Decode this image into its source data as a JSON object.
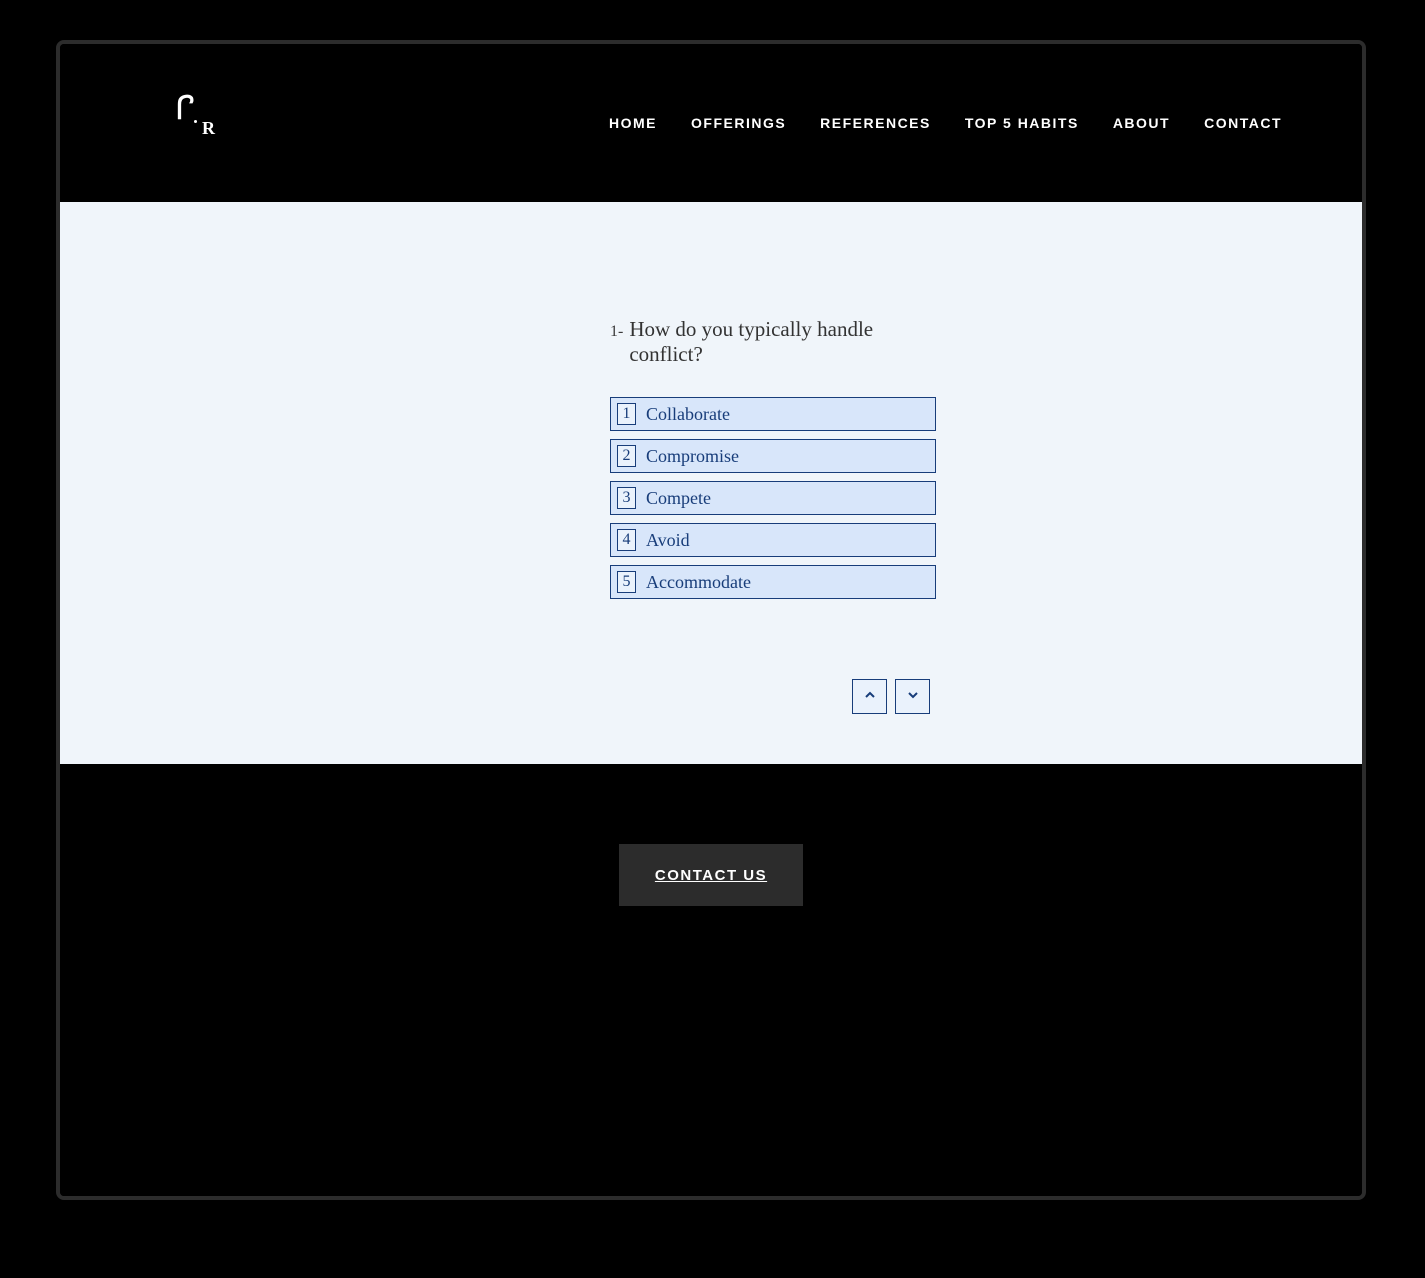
{
  "nav": {
    "items": [
      {
        "label": "HOME"
      },
      {
        "label": "OFFERINGS"
      },
      {
        "label": "REFERENCES"
      },
      {
        "label": "TOP 5 HABITS"
      },
      {
        "label": "ABOUT"
      },
      {
        "label": "CONTACT"
      }
    ]
  },
  "question": {
    "number": "1-",
    "text": "How do you typically handle conflict?",
    "options": [
      {
        "num": "1",
        "label": "Collaborate"
      },
      {
        "num": "2",
        "label": "Compromise"
      },
      {
        "num": "3",
        "label": "Compete"
      },
      {
        "num": "4",
        "label": "Avoid"
      },
      {
        "num": "5",
        "label": "Accommodate"
      }
    ]
  },
  "cta": {
    "label": "CONTACT US"
  }
}
